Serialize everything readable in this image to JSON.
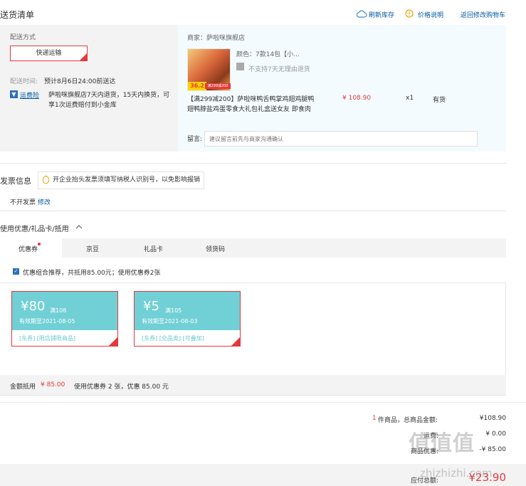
{
  "header": {
    "title": "送货清单",
    "refresh_stock": "刷新库存",
    "price_info": "价格说明",
    "back_to_cart": "返回修改购物车"
  },
  "shipping": {
    "method_label": "配送方式",
    "method_value": "快递运输",
    "time_label": "配送时间:",
    "time_value": "预计8月6日24:00前送达",
    "insurance_label": "运费险",
    "insurance_desc_line1": "萨啦咪旗舰店7天内退货，15天内换货，可",
    "insurance_desc_line2": "享1次运费赔付到小金库"
  },
  "order": {
    "merchant": "商家：萨啦咪旗舰店",
    "color_spec": "颜色：7款14包【小...",
    "return_policy": "不支持7天无理由退货",
    "product_name_line1": "【满299减200】萨啦咪鸭舌鸭掌鸡翅鸡腿鸭",
    "product_name_line2": "翅鸭脖盐鸡蛋零食大礼包礼盒送女友 即食肉",
    "price": "¥ 108.90",
    "quantity": "x1",
    "stock": "有货",
    "img_sticker": "36.2",
    "img_promo": "满299减200",
    "message_label": "留言:",
    "message_placeholder": "建议留言前先与商家沟通确认"
  },
  "invoice": {
    "title": "发票信息",
    "tip": "开企业抬头发票须填写纳税人识别号，以免影响报销",
    "status": "不开发票",
    "modify": "修改"
  },
  "discount": {
    "title": "使用优惠/礼品卡/抵用",
    "tabs": [
      "优惠券",
      "京豆",
      "礼品卡",
      "领货码"
    ],
    "recommend_text": "优惠组合推荐，共抵用85.00元；使用优惠券2张",
    "coupons": [
      {
        "amount": "¥80",
        "condition": "满108",
        "expiry": "有效期至2021-08-05",
        "tags": "[东券] [限店铺限商品]"
      },
      {
        "amount": "¥5",
        "condition": "满105",
        "expiry": "有效期至2021-08-03",
        "tags": "[东券] [全品类] [可叠加]"
      }
    ],
    "summary_label": "金额抵用",
    "summary_value": "¥ 85.00",
    "summary_detail": "使用优惠券 2 张，优惠 85.00 元"
  },
  "totals": {
    "count_prefix": "1",
    "items_label": "件商品，总商品金额:",
    "items_value": "¥108.90",
    "freight_label": "运费:",
    "freight_value": "¥ 0.00",
    "discount_label": "商品优惠:",
    "discount_value": "-¥ 85.00",
    "payable_label": "应付总额:",
    "payable_value": "¥23.90"
  },
  "watermark": {
    "text": "值值值",
    "url": "zhizhizhi.com"
  }
}
